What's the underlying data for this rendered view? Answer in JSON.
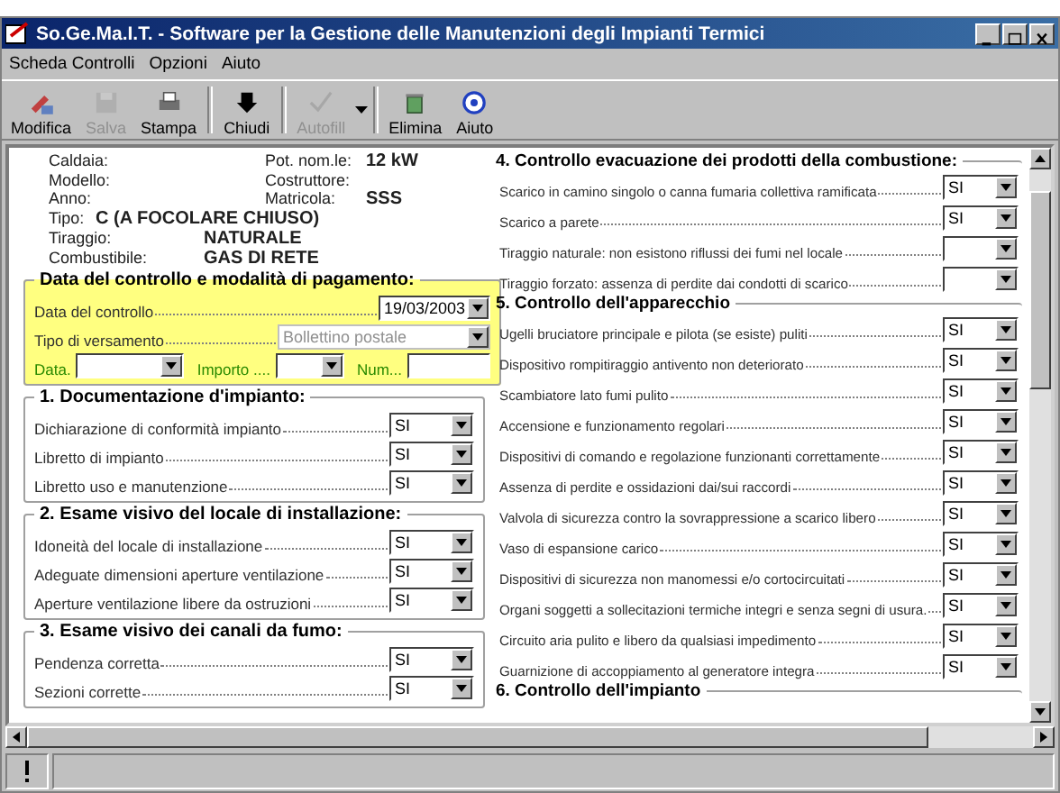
{
  "window": {
    "title": "So.Ge.Ma.I.T. - Software per la Gestione delle Manutenzioni degli Impianti Termici"
  },
  "menu": [
    "Scheda Controlli",
    "Opzioni",
    "Aiuto"
  ],
  "toolbar": [
    {
      "label": "Modifica",
      "disabled": false
    },
    {
      "label": "Salva",
      "disabled": true
    },
    {
      "label": "Stampa",
      "disabled": false
    },
    {
      "label": "Chiudi",
      "disabled": false
    },
    {
      "label": "Autofill",
      "disabled": true
    },
    {
      "label": "Elimina",
      "disabled": false
    },
    {
      "label": "Aiuto",
      "disabled": false
    }
  ],
  "info": [
    {
      "label": "Caldaia:",
      "label_2": "Pot. nom.le:",
      "value_2": "12 kW"
    },
    {
      "label": "Modello:",
      "label_2": "Costruttore:"
    },
    {
      "label": "Anno:",
      "label_2": "Matricola:",
      "value_2": "SSS"
    },
    {
      "label": "Tipo:",
      "value": "C (A FOCOLARE CHIUSO)"
    },
    {
      "label": "Tiraggio:",
      "value": "NATURALE"
    },
    {
      "label": "Combustibile:",
      "value": "GAS DI RETE"
    }
  ],
  "payment": {
    "title": "Data del controllo e modalità di pagamento:",
    "date_label": "Data del controllo",
    "date_value": "19/03/2003",
    "type_label": "Tipo di versamento",
    "type_value": "Bollettino postale",
    "type_disabled": true,
    "data_label": "Data.",
    "amount_label": "Importo ....",
    "num_label": "Num..."
  },
  "sections_left": [
    {
      "title": "1. Documentazione d'impianto:",
      "items": [
        {
          "label": "Dichiarazione di conformità impianto",
          "value": "SI"
        },
        {
          "label": "Libretto di impianto",
          "value": "SI"
        },
        {
          "label": "Libretto uso e manutenzione",
          "value": "SI"
        }
      ]
    },
    {
      "title": "2. Esame visivo del locale di installazione:",
      "items": [
        {
          "label": "Idoneità del locale di installazione",
          "value": "SI"
        },
        {
          "label": "Adeguate dimensioni aperture ventilazione",
          "value": "SI"
        },
        {
          "label": "Aperture ventilazione libere da ostruzioni",
          "value": "SI"
        }
      ]
    },
    {
      "title": "3. Esame visivo dei canali da fumo:",
      "items": [
        {
          "label": "Pendenza corretta",
          "value": "SI"
        },
        {
          "label": "Sezioni corrette",
          "value": "SI"
        }
      ]
    }
  ],
  "sections_right": [
    {
      "title": "4. Controllo evacuazione dei prodotti della combustione:",
      "items": [
        {
          "label": "Scarico in camino singolo o canna fumaria collettiva ramificata",
          "value": "SI"
        },
        {
          "label": "Scarico a parete",
          "value": "SI"
        },
        {
          "label": "Tiraggio naturale: non esistono riflussi dei fumi nel locale"
        },
        {
          "label": "Tiraggio forzato: assenza di perdite dai condotti di scarico"
        }
      ]
    },
    {
      "title": "5. Controllo dell'apparecchio",
      "items": [
        {
          "label": "Ugelli bruciatore principale e pilota (se esiste) puliti",
          "value": "SI"
        },
        {
          "label": "Dispositivo rompitiraggio antivento non deteriorato",
          "value": "SI"
        },
        {
          "label": "Scambiatore lato fumi pulito",
          "value": "SI"
        },
        {
          "label": "Accensione e funzionamento regolari",
          "value": "SI"
        },
        {
          "label": "Dispositivi di comando e regolazione funzionanti correttamente",
          "value": "SI"
        },
        {
          "label": "Assenza di perdite e ossidazioni dai/sui raccordi",
          "value": "SI"
        },
        {
          "label": "Valvola di sicurezza contro la sovrappressione a scarico libero",
          "value": "SI"
        },
        {
          "label": "Vaso di espansione carico",
          "value": "SI"
        },
        {
          "label": "Dispositivi di sicurezza non manomessi e/o cortocircuitati",
          "value": "SI"
        },
        {
          "label": "Organi soggetti a sollecitazioni termiche integri e senza segni di usura.",
          "value": "SI"
        },
        {
          "label": "Circuito aria pulito e libero da qualsiasi impedimento",
          "value": "SI"
        },
        {
          "label": "Guarnizione di accoppiamento al generatore integra",
          "value": "SI"
        }
      ]
    },
    {
      "title": "6. Controllo dell'impianto"
    }
  ]
}
